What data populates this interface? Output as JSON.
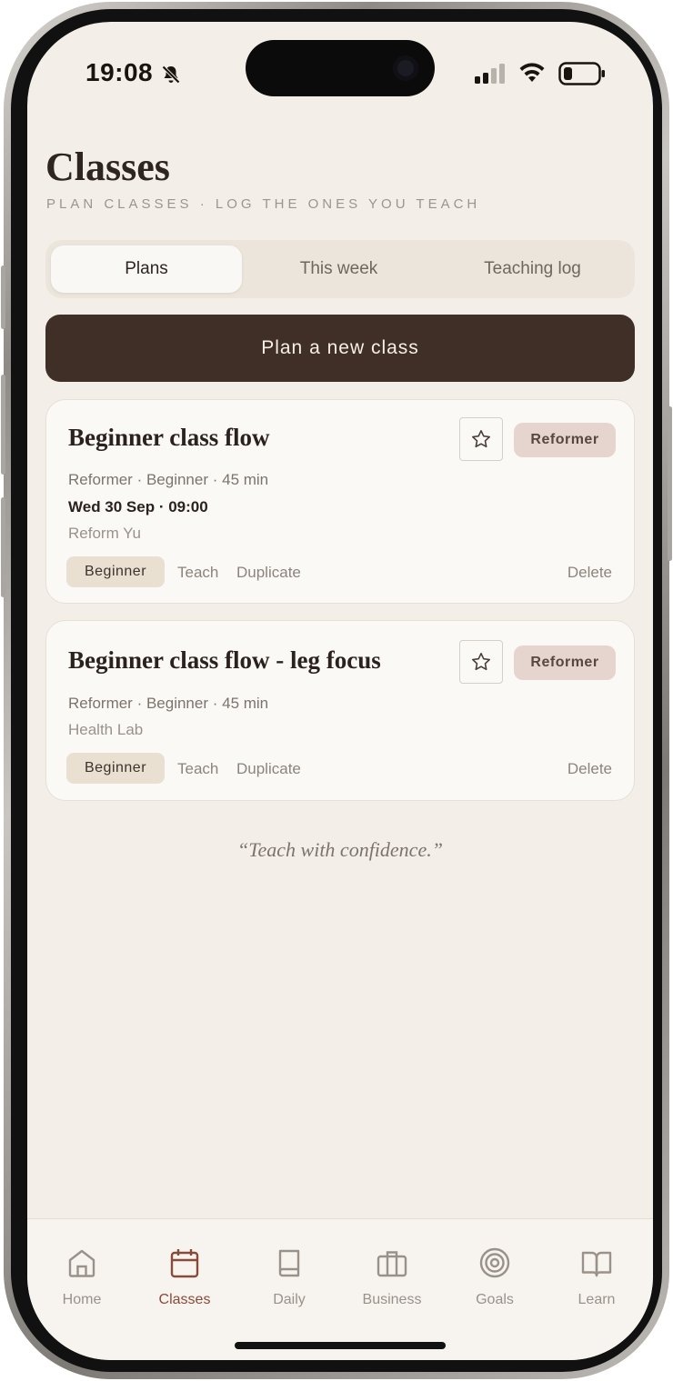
{
  "status_bar": {
    "time": "19:08",
    "silent_icon": "bell-slash-icon",
    "signal_icon": "cellular-signal-icon",
    "wifi_icon": "wifi-icon",
    "battery_icon": "battery-low-icon"
  },
  "header": {
    "title": "Classes",
    "subtitle": "PLAN CLASSES · LOG THE ONES YOU TEACH"
  },
  "tabs": [
    {
      "label": "Plans",
      "active": true
    },
    {
      "label": "This week",
      "active": false
    },
    {
      "label": "Teaching log",
      "active": false
    }
  ],
  "primary_action": {
    "label": "Plan a new class"
  },
  "cards": [
    {
      "title": "Beginner class flow",
      "meta": "Reformer · Beginner · 45 min",
      "schedule": "Wed 30 Sep · 09:00",
      "location": "Reform Yu",
      "apparatus": "Reformer",
      "level": "Beginner",
      "actions": {
        "teach": "Teach",
        "duplicate": "Duplicate",
        "delete": "Delete"
      }
    },
    {
      "title": "Beginner class flow - leg focus",
      "meta": "Reformer · Beginner · 45 min",
      "location": "Health Lab",
      "apparatus": "Reformer",
      "level": "Beginner",
      "actions": {
        "teach": "Teach",
        "duplicate": "Duplicate",
        "delete": "Delete"
      }
    }
  ],
  "quote": "“Teach with confidence.”",
  "nav": [
    {
      "label": "Home",
      "icon": "home-icon",
      "active": false
    },
    {
      "label": "Classes",
      "icon": "calendar-icon",
      "active": true
    },
    {
      "label": "Daily",
      "icon": "book-icon",
      "active": false
    },
    {
      "label": "Business",
      "icon": "briefcase-icon",
      "active": false
    },
    {
      "label": "Goals",
      "icon": "target-icon",
      "active": false
    },
    {
      "label": "Learn",
      "icon": "open-book-icon",
      "active": false
    }
  ],
  "colors": {
    "background": "#f3efe8",
    "primary_button": "#402f27",
    "accent_active": "#8a4a3a",
    "pill": "#e6d4cf",
    "level_chip": "#e9e0d1"
  }
}
